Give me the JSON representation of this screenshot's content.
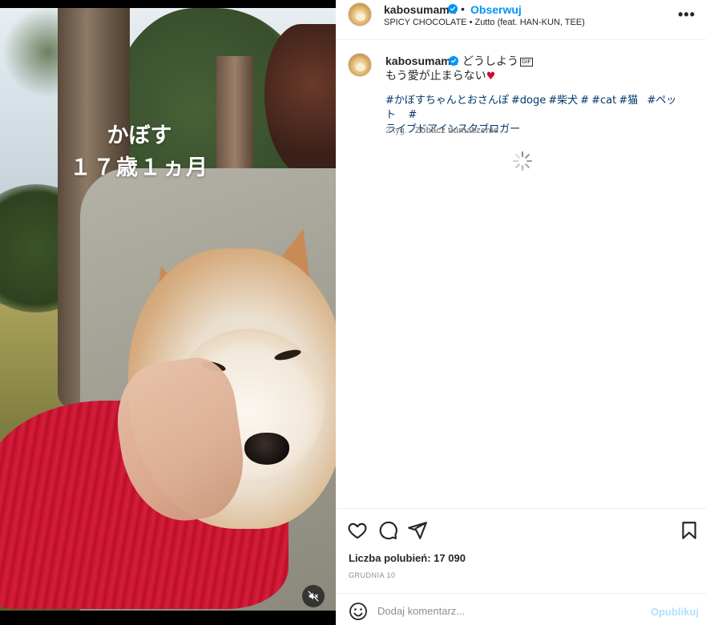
{
  "media": {
    "overlay_line1": "かぼす",
    "overlay_line2": "１７歳１ヵ月",
    "mute_icon": "speaker-muted-icon"
  },
  "header": {
    "username": "kabosumama",
    "separator": "•",
    "follow_label": "Obserwuj",
    "audio": "SPICY CHOCOLATE • Zutto (feat. HAN-KUN, TEE)",
    "more_label": "•••"
  },
  "caption": {
    "username": "kabosumama",
    "line1": "どうしよう",
    "gif_badge": "GIF",
    "line2": "もう愛が止まらない",
    "heart": "♥",
    "hashtags": [
      "#かぼすちゃんとおさんぽ",
      "#doge",
      "#柴犬",
      "#",
      "#cat",
      "#猫",
      "#ペット",
      "#",
      "ライブドアインスタブロガー"
    ],
    "age": "2 tyg.",
    "translate_label": "Zobacz tłumaczenie"
  },
  "actions": {
    "likes_text": "Liczba polubień: 17 090",
    "date": "GRUDNIA 10"
  },
  "comment": {
    "placeholder": "Dodaj komentarz...",
    "publish_label": "Opublikuj"
  },
  "colors": {
    "accent_blue": "#0095f6",
    "hashtag_blue": "#00376b",
    "publish_disabled": "#b2dffc",
    "muted_text": "#8e8e8e",
    "sweater_red": "#c8102e"
  }
}
